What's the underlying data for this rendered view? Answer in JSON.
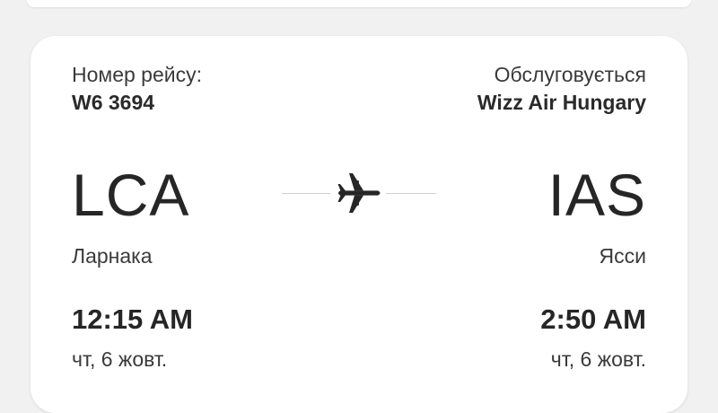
{
  "flight": {
    "number_label": "Номер рейсу:",
    "number": "W6 3694",
    "operated_label": "Обслуговується",
    "operator": "Wizz Air Hungary"
  },
  "departure": {
    "code": "LCA",
    "city": "Ларнака",
    "time": "12:15 AM",
    "date": "чт, 6 жовт."
  },
  "arrival": {
    "code": "IAS",
    "city": "Ясси",
    "time": "2:50 AM",
    "date": "чт, 6 жовт."
  },
  "icons": {
    "route": "airplane-icon"
  },
  "colors": {
    "background": "#f1f1f1",
    "card": "#ffffff",
    "text": "#2b2b2b",
    "route_line": "#cfcfcf"
  }
}
